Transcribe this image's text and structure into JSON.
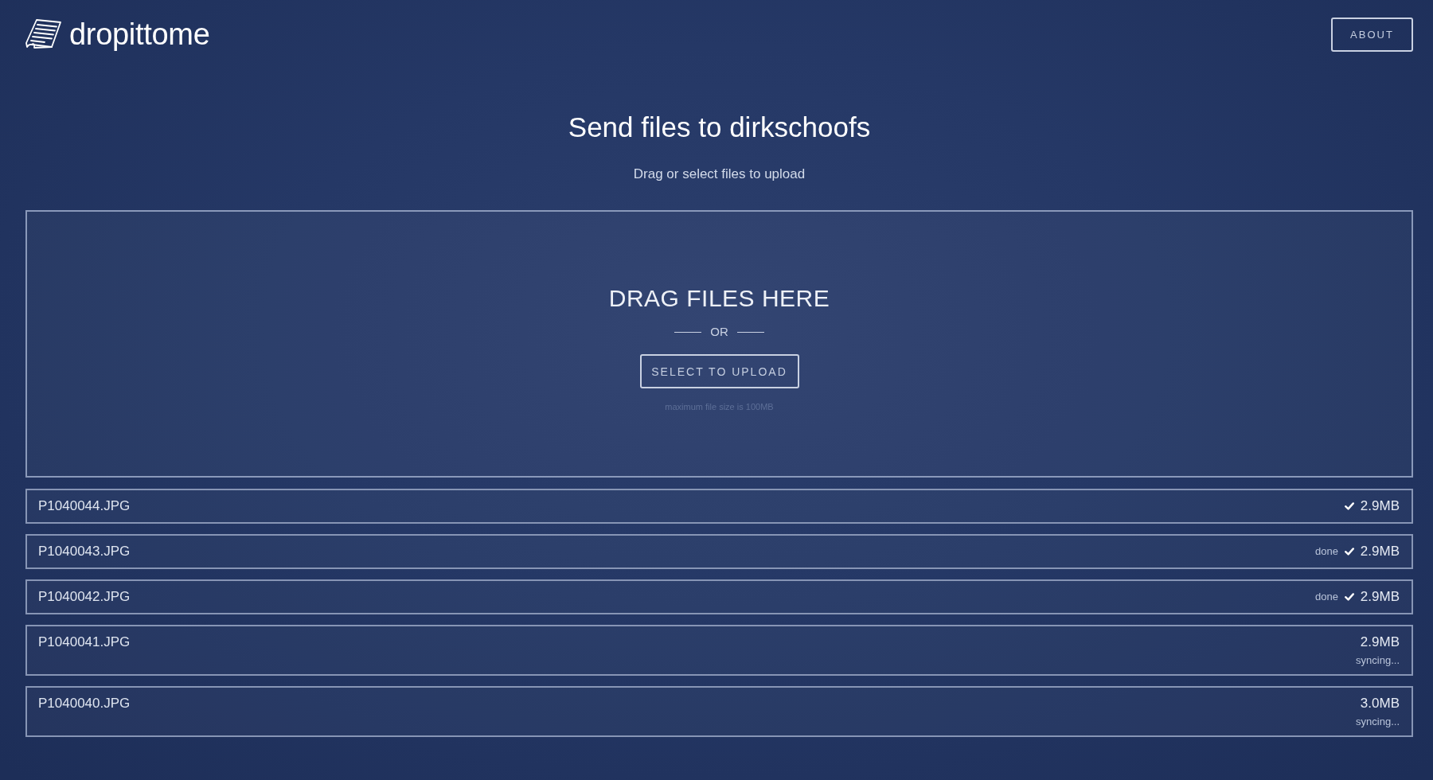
{
  "header": {
    "logo_text": "dropittome",
    "about_button": "ABOUT"
  },
  "title": "Send files to dirkschoofs",
  "subtitle": "Drag or select files to upload",
  "drop_zone": {
    "heading": "DRAG FILES HERE",
    "separator": "OR",
    "button": "SELECT TO UPLOAD",
    "note": "maximum file size is 100MB"
  },
  "files": [
    {
      "kind": "uploaded",
      "name": "P1040044.JPG",
      "size": "2.9MB",
      "complete": true
    },
    {
      "kind": "uploaded",
      "name": "P1040043.JPG",
      "size": "2.9MB",
      "status": "done",
      "complete": true
    },
    {
      "kind": "uploaded",
      "name": "P1040042.JPG",
      "size": "2.9MB",
      "status": "done",
      "complete": true
    },
    {
      "kind": "syncing",
      "name": "P1040041.JPG",
      "size": "2.9MB",
      "status": "syncing...",
      "complete": false
    },
    {
      "kind": "syncing",
      "name": "P1040040.JPG",
      "size": "3.0MB",
      "status": "syncing...",
      "complete": false
    }
  ]
}
